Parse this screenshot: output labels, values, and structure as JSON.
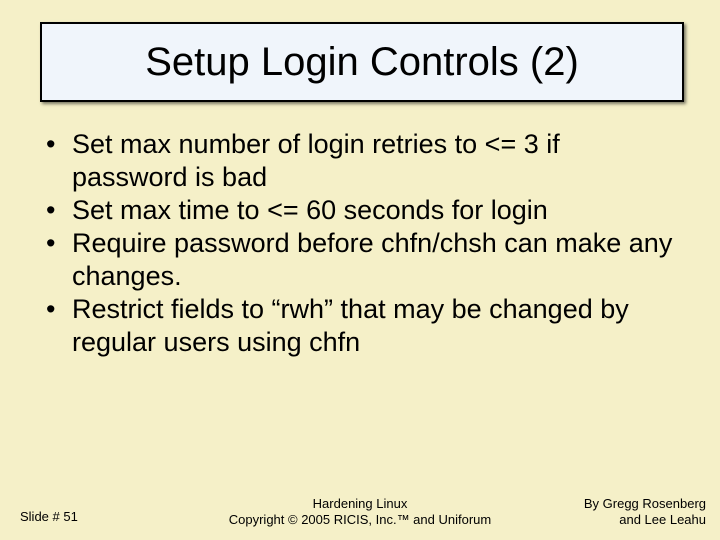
{
  "title": "Setup Login Controls (2)",
  "bullets": [
    "Set max number of login retries to <= 3 if password is bad",
    "Set max time to <= 60 seconds for login",
    "Require password before chfn/chsh can make any changes.",
    "Restrict fields to “rwh” that may be changed by regular users using chfn"
  ],
  "footer": {
    "slide_number": "Slide # 51",
    "center_line1": "Hardening Linux",
    "center_line2": "Copyright © 2005 RICIS, Inc.™ and Uniforum",
    "right_line1": "By Gregg Rosenberg",
    "right_line2": "and Lee Leahu"
  }
}
